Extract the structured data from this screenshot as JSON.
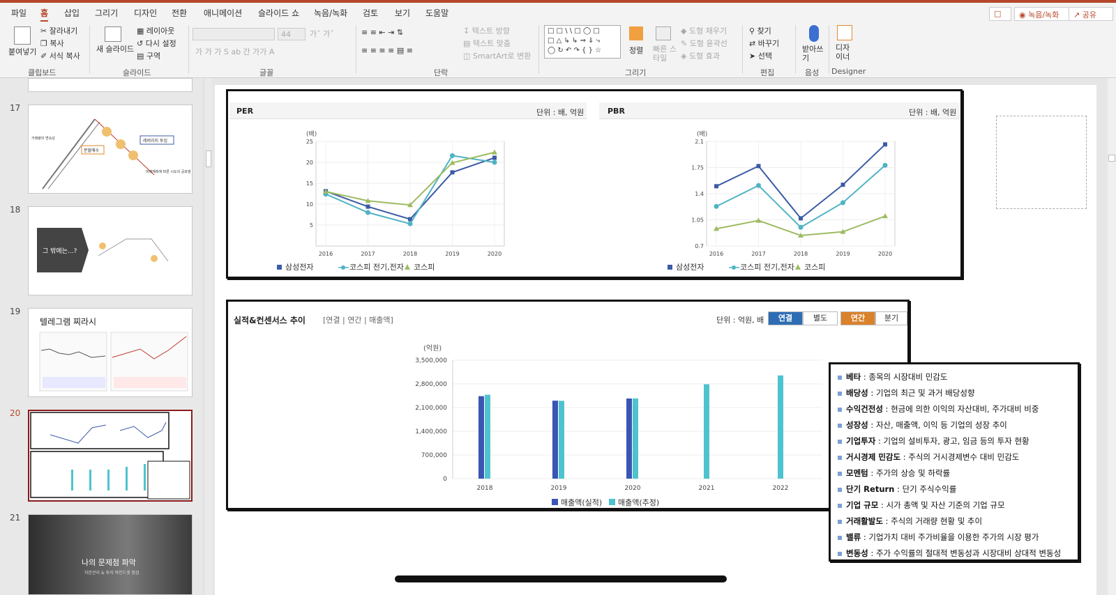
{
  "tabs": [
    "파일",
    "홈",
    "삽입",
    "그리기",
    "디자인",
    "전환",
    "애니메이션",
    "슬라이드 쇼",
    "녹음/녹화",
    "검토",
    "보기",
    "도움말"
  ],
  "top_buttons": {
    "comment": "",
    "record": "녹음/녹화",
    "share": "공유"
  },
  "ribbon": {
    "clipboard": {
      "paste": "붙여넣기",
      "cut": "잘라내기",
      "copy": "복사",
      "format_painter": "서식 복사",
      "label": "클립보드"
    },
    "slides": {
      "new_slide": "새 슬라이드",
      "layout": "레이아웃",
      "reset": "다시 설정",
      "section": "구역",
      "label": "슬라이드"
    },
    "font": {
      "label": "글꼴",
      "size": "44"
    },
    "paragraph": {
      "text_direction": "텍스트 방향",
      "align_text": "텍스트 맞춤",
      "smartart": "SmartArt로 변환",
      "label": "단락"
    },
    "drawing": {
      "arrange": "정렬",
      "quick_styles": "빠른 스타일",
      "shape_fill": "도형 채우기",
      "shape_outline": "도형 윤곽선",
      "shape_effects": "도형 효과",
      "label": "그리기"
    },
    "editing": {
      "find": "찾기",
      "replace": "바꾸기",
      "select": "선택",
      "label": "편집"
    },
    "voice": {
      "dictate": "받아쓰기",
      "label": "음성"
    },
    "designer": {
      "button": "디자이너",
      "label": "Designer"
    }
  },
  "slides_panel": {
    "items": [
      {
        "number": "17",
        "texts": [
          "레버리지 투입",
          "분할매수",
          "거래량의 연속성",
          "미래예측에 따른 시도의 공포점"
        ]
      },
      {
        "number": "18",
        "texts": [
          "그 밖에는...?"
        ]
      },
      {
        "number": "19",
        "texts": [
          "텔레그램 찌라시"
        ]
      },
      {
        "number": "20",
        "texts": []
      },
      {
        "number": "21",
        "texts": [
          "나의 문제점 파악",
          "자본관리 & 투자 마인드셋 점검"
        ]
      }
    ],
    "selected": "20"
  },
  "per_panel": {
    "title": "PER",
    "unit": "단위 : 배, 억원"
  },
  "pbr_panel": {
    "title": "PBR",
    "unit": "단위 : 배, 억원"
  },
  "sales_panel": {
    "title": "실적&컨센서스 추이",
    "subtitle": "[연결 | 연간 | 매출액]",
    "unit": "단위 : 억원, 배",
    "buttons": {
      "consolidated": "연결",
      "separate": "별도",
      "annual": "연간",
      "quarterly": "분기"
    }
  },
  "colors": {
    "samsung": "#3b5ba5",
    "kospi_elec": "#4fb3c4",
    "kospi": "#9dbb61",
    "bar_actual": "#3a55b4",
    "bar_estimate": "#4ec3cf",
    "accent": "#b7472a"
  },
  "chart_data": [
    {
      "type": "line",
      "title": "PER",
      "ylabel": "(배)",
      "x": [
        "2016",
        "2017",
        "2018",
        "2019",
        "2020"
      ],
      "yticks": [
        5,
        10,
        15,
        20,
        25
      ],
      "ylim": [
        0,
        25
      ],
      "series": [
        {
          "name": "삼성전자",
          "values": [
            13.1,
            9.4,
            6.4,
            17.6,
            21.1
          ]
        },
        {
          "name": "코스피 전기,전자",
          "values": [
            12.4,
            8.0,
            5.3,
            21.6,
            20.0
          ]
        },
        {
          "name": "코스피",
          "values": [
            13.0,
            10.8,
            9.8,
            19.9,
            22.4
          ]
        }
      ],
      "legend": "bottom"
    },
    {
      "type": "line",
      "title": "PBR",
      "ylabel": "(배)",
      "x": [
        "2016",
        "2017",
        "2018",
        "2019",
        "2020"
      ],
      "yticks": [
        "0.7",
        "1.05",
        "1.4",
        "1.75",
        "2.1"
      ],
      "ylim": [
        0.7,
        2.1
      ],
      "series": [
        {
          "name": "삼성전자",
          "values": [
            1.5,
            1.77,
            1.07,
            1.52,
            2.06
          ]
        },
        {
          "name": "코스피 전기,전자",
          "values": [
            1.23,
            1.51,
            0.95,
            1.28,
            1.78
          ]
        },
        {
          "name": "코스피",
          "values": [
            0.93,
            1.04,
            0.84,
            0.89,
            1.1
          ]
        }
      ],
      "legend": "bottom"
    },
    {
      "type": "bar",
      "ylabel": "(억원)",
      "categories": [
        "2018",
        "2019",
        "2020",
        "2021",
        "2022"
      ],
      "yticks": [
        "0",
        "700,000",
        "1,400,000",
        "2,100,000",
        "2,800,000",
        "3,500,000"
      ],
      "ylim": [
        0,
        3500000
      ],
      "series": [
        {
          "name": "매출액(실적)",
          "values": [
            2437714,
            2304009,
            2368070,
            null,
            null
          ]
        },
        {
          "name": "매출액(추정)",
          "values": [
            2480000,
            2300000,
            2370000,
            2790000,
            3050000
          ]
        }
      ],
      "legend": "bottom"
    }
  ],
  "metrics": [
    {
      "term": "베타",
      "desc": "종목의 시장대비 민감도"
    },
    {
      "term": "배당성",
      "desc": "기업의 최근 및 과거 배당성향"
    },
    {
      "term": "수익건전성",
      "desc": "현금에 의한 이익의 자산대비, 주가대비 비중"
    },
    {
      "term": "성장성",
      "desc": "자산, 매출액, 이익 등 기업의 성장 추이"
    },
    {
      "term": "기업투자",
      "desc": "기업의 설비투자, 광고, 임금 등의 투자 현황"
    },
    {
      "term": "거시경제 민감도",
      "desc": "주식의 거시경제변수 대비 민감도"
    },
    {
      "term": "모멘텀",
      "desc": "주가의 상승 및 하락률"
    },
    {
      "term": "단기 Return",
      "desc": "단기 주식수익률"
    },
    {
      "term": "기업 규모",
      "desc": "시가 총액 및 자산 기준의 기업 규모"
    },
    {
      "term": "거래활발도",
      "desc": "주식의 거래량 현황 및 추이"
    },
    {
      "term": "밸류",
      "desc": "기업가치 대비 주가비율을 이용한 주가의 시장 평가"
    },
    {
      "term": "변동성",
      "desc": "주가 수익률의 절대적 변동성과 시장대비 상대적 변동성"
    }
  ]
}
